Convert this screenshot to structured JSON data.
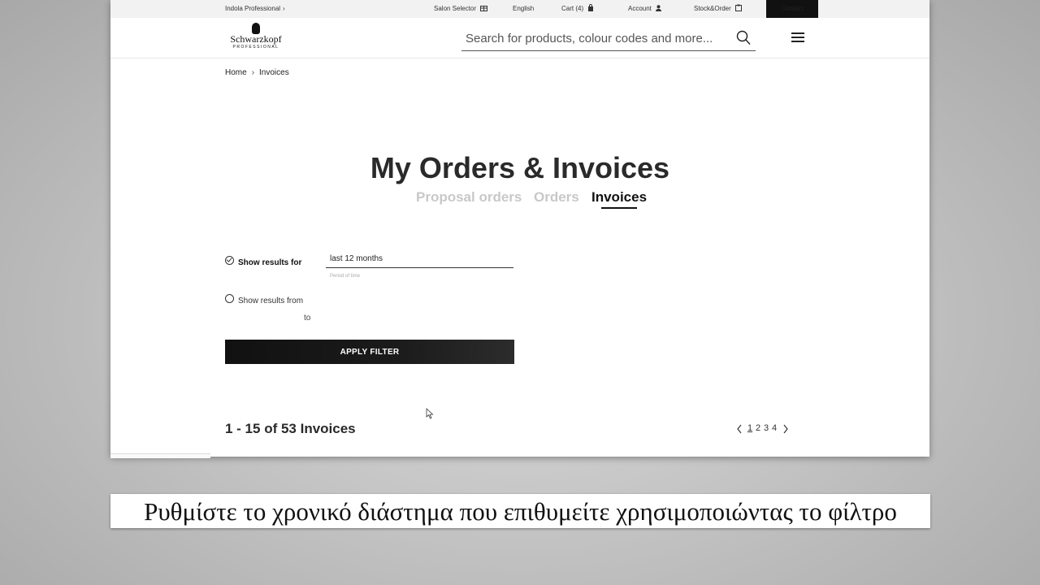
{
  "topbar": {
    "indola": "Indola Professional",
    "salon_selector": "Salon Selector",
    "language": "English",
    "cart": "Cart (4)",
    "account": "Account",
    "stock_order": "Stock&Order",
    "contact": "Contact"
  },
  "header": {
    "logo_brand": "Schwarzkopf",
    "logo_sub": "PROFESSIONAL",
    "search_placeholder": "Search for products, colour codes and more..."
  },
  "breadcrumb": {
    "home": "Home",
    "current": "Invoices"
  },
  "page": {
    "title": "My Orders & Invoices",
    "tabs": [
      {
        "label": "Proposal orders",
        "active": false
      },
      {
        "label": "Orders",
        "active": false
      },
      {
        "label": "Invoices",
        "active": true
      }
    ]
  },
  "filter": {
    "option_period_label": "Show results for",
    "option_period_selected": true,
    "period_value": "last 12 months",
    "period_hint": "Period of time",
    "option_range_label": "Show results from",
    "option_range_selected": false,
    "to_label": "to",
    "apply_label": "APPLY FILTER"
  },
  "results": {
    "summary": "1 - 15 of 53 Invoices",
    "pages": [
      "1",
      "2",
      "3",
      "4"
    ],
    "current_page": "1"
  },
  "subtitle": "Ρυθμίστε το χρονικό διάστημα που επιθυμείτε χρησιμοποιώντας το φίλτρο"
}
